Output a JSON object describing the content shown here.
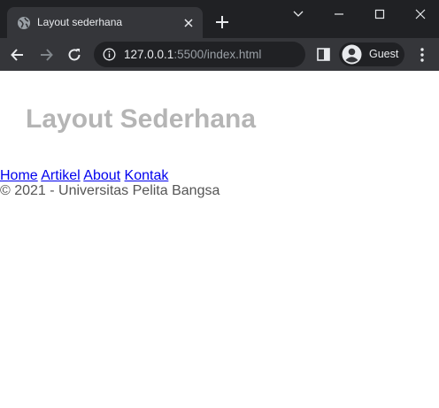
{
  "browser": {
    "tab": {
      "title": "Layout sederhana"
    },
    "address": {
      "host": "127.0.0.1",
      "rest": ":5500/index.html"
    },
    "profile": {
      "name": "Guest"
    },
    "colors": {
      "frame": "#202124",
      "toolbar": "#35363a",
      "text": "#e8eaed",
      "muted": "#9aa0a6"
    }
  },
  "page": {
    "title": "Layout Sederhana",
    "nav": [
      {
        "label": "Home"
      },
      {
        "label": "Artikel"
      },
      {
        "label": "About"
      },
      {
        "label": "Kontak"
      }
    ],
    "footer": "© 2021 - Universitas Pelita Bangsa",
    "colors": {
      "title": "#b5b5b5",
      "link": "#0000ee",
      "footer": "#555555"
    }
  }
}
